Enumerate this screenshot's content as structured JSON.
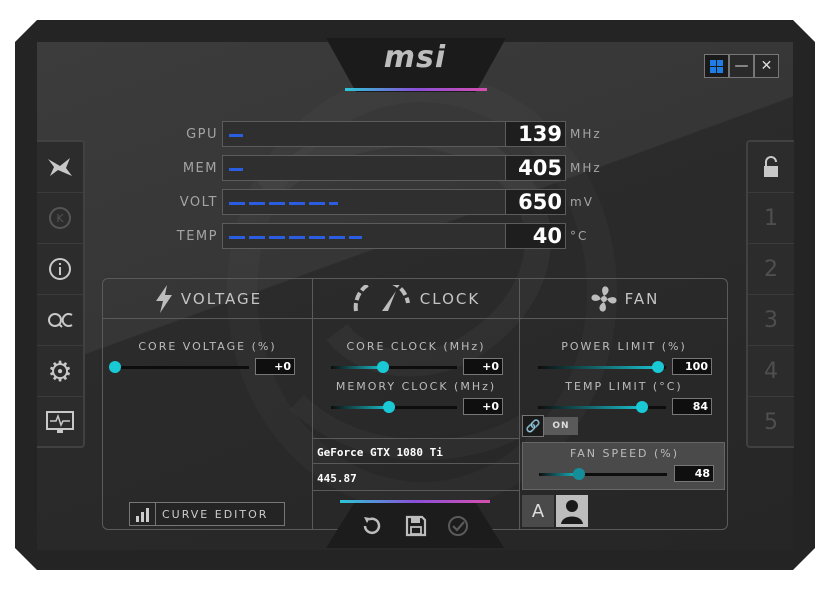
{
  "app": {
    "brand": "msi"
  },
  "window_controls": {
    "minimize": "—",
    "close": "✕"
  },
  "monitors": [
    {
      "label": "GPU",
      "value": "139",
      "unit": "MHz",
      "fill": 0.04
    },
    {
      "label": "MEM",
      "value": "405",
      "unit": "MHz",
      "fill": 0.04
    },
    {
      "label": "VOLT",
      "value": "650",
      "unit": "mV",
      "fill": 0.32
    },
    {
      "label": "TEMP",
      "value": "40",
      "unit": "°C",
      "fill": 0.39
    }
  ],
  "left_sidebar": [
    {
      "name": "msi-dragon-icon",
      "glyph": "✦",
      "active": true
    },
    {
      "name": "kombustor-icon",
      "glyph": "Ⓚ",
      "active": false
    },
    {
      "name": "info-icon",
      "glyph": "ⓘ",
      "active": true
    },
    {
      "name": "oc-scanner-icon",
      "glyph": "OC",
      "active": true
    },
    {
      "name": "settings-gear-icon",
      "glyph": "⚙",
      "active": true
    },
    {
      "name": "monitor-icon",
      "glyph": "▭",
      "active": true
    }
  ],
  "right_sidebar": [
    {
      "name": "lock-icon",
      "label": "🔓",
      "active": true
    },
    {
      "name": "profile-1",
      "label": "1",
      "active": false
    },
    {
      "name": "profile-2",
      "label": "2",
      "active": false
    },
    {
      "name": "profile-3",
      "label": "3",
      "active": false
    },
    {
      "name": "profile-4",
      "label": "4",
      "active": false
    },
    {
      "name": "profile-5",
      "label": "5",
      "active": false
    }
  ],
  "voltage": {
    "title": "VOLTAGE",
    "core_voltage_label": "CORE VOLTAGE  (%)",
    "core_voltage_value": "+0",
    "core_voltage_level": 0.0,
    "curve_editor_label": "CURVE EDITOR"
  },
  "clock": {
    "title": "CLOCK",
    "core_clock_label": "CORE CLOCK (MHz)",
    "core_clock_value": "+0",
    "memory_clock_label": "MEMORY CLOCK (MHz)",
    "memory_clock_value": "+0",
    "gpu_name": "GeForce GTX 1080 Ti",
    "driver_version": "445.87"
  },
  "fan": {
    "title": "FAN",
    "power_limit_label": "POWER LIMIT (%)",
    "power_limit_value": "100",
    "temp_limit_label": "TEMP LIMIT (°C)",
    "temp_limit_value": "84",
    "link_label": "ON",
    "fan_speed_label": "FAN SPEED (%)",
    "fan_speed_value": "48",
    "auto_label": "A"
  },
  "colors": {
    "accent": "#19c9d6",
    "monitor_fill": "#2b5de0",
    "background": "#242424"
  }
}
